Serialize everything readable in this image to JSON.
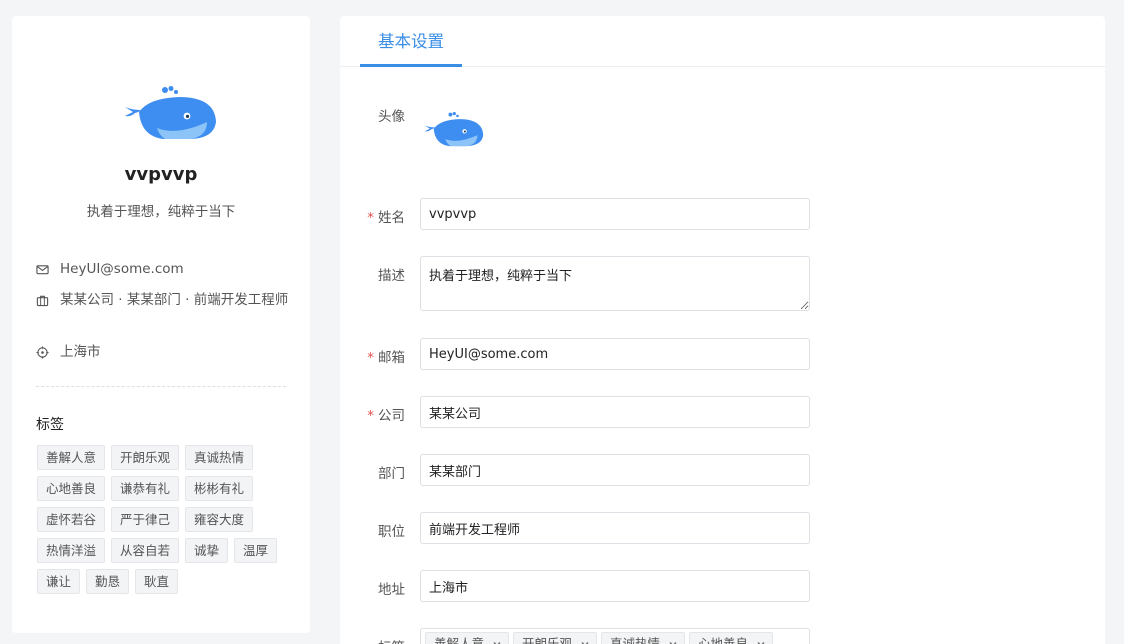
{
  "profile": {
    "name": "vvpvvp",
    "bio": "执着于理想，纯粹于当下",
    "email": "HeyUI@some.com",
    "job": "某某公司 · 某某部门 · 前端开发工程师",
    "city": "上海市",
    "tags_title": "标签",
    "tags": [
      "善解人意",
      "开朗乐观",
      "真诚热情",
      "心地善良",
      "谦恭有礼",
      "彬彬有礼",
      "虚怀若谷",
      "严于律己",
      "雍容大度",
      "热情洋溢",
      "从容自若",
      "诚挚",
      "温厚",
      "谦让",
      "勤恳",
      "耿直"
    ]
  },
  "settings": {
    "tab": "基本设置",
    "labels": {
      "avatar": "头像",
      "name": "姓名",
      "desc": "描述",
      "email": "邮箱",
      "company": "公司",
      "department": "部门",
      "position": "职位",
      "address": "地址",
      "tags": "标签"
    },
    "required_mark": "*",
    "values": {
      "name": "vvpvvp",
      "desc": "执着于理想，纯粹于当下",
      "email": "HeyUI@some.com",
      "company": "某某公司",
      "department": "某某部门",
      "position": "前端开发工程师",
      "address": "上海市"
    },
    "selected_tags": [
      "善解人意",
      "开朗乐观",
      "真诚热情",
      "心地善良"
    ]
  },
  "colors": {
    "accent": "#3a8ee6",
    "required": "#e05050",
    "whale": "#3d8ef0"
  },
  "icons": {
    "email": "mail-icon",
    "job": "briefcase-icon",
    "city": "location-icon",
    "tag_remove": "close-icon",
    "avatar": "whale-icon"
  }
}
